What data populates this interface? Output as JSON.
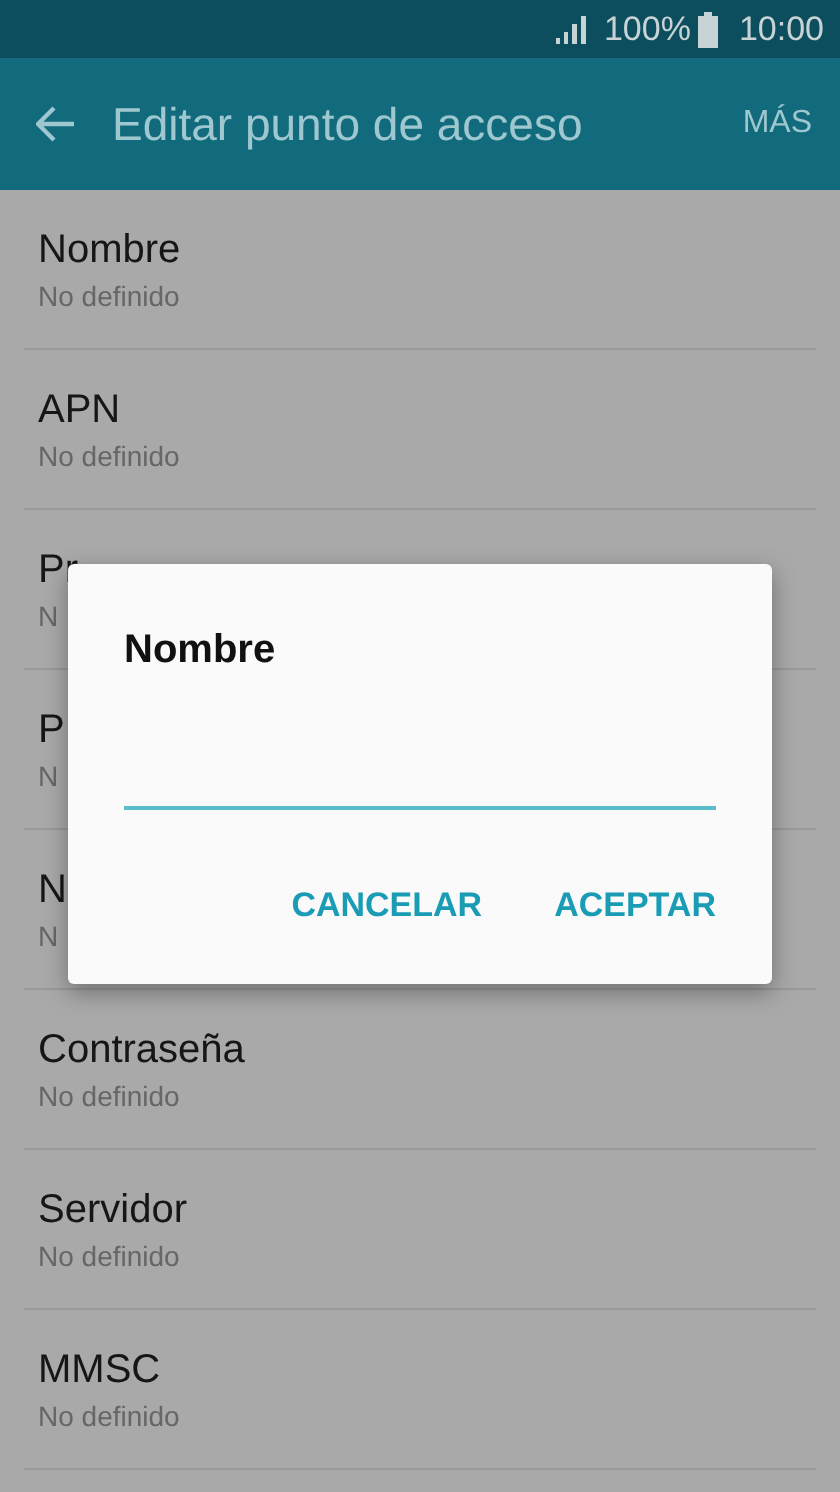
{
  "status_bar": {
    "battery": "100%",
    "time": "10:00"
  },
  "app_bar": {
    "title": "Editar punto de acceso",
    "action": "MÁS"
  },
  "rows": [
    {
      "title": "Nombre",
      "subtitle": "No definido"
    },
    {
      "title": "APN",
      "subtitle": "No definido"
    },
    {
      "title": "Pr",
      "subtitle": "N"
    },
    {
      "title": "P",
      "subtitle": "N"
    },
    {
      "title": "N",
      "subtitle": "N"
    },
    {
      "title": "Contraseña",
      "subtitle": "No definido"
    },
    {
      "title": "Servidor",
      "subtitle": "No definido"
    },
    {
      "title": "MMSC",
      "subtitle": "No definido"
    }
  ],
  "dialog": {
    "title": "Nombre",
    "buttons": [
      "CANCELAR",
      "ACEPTAR"
    ]
  }
}
